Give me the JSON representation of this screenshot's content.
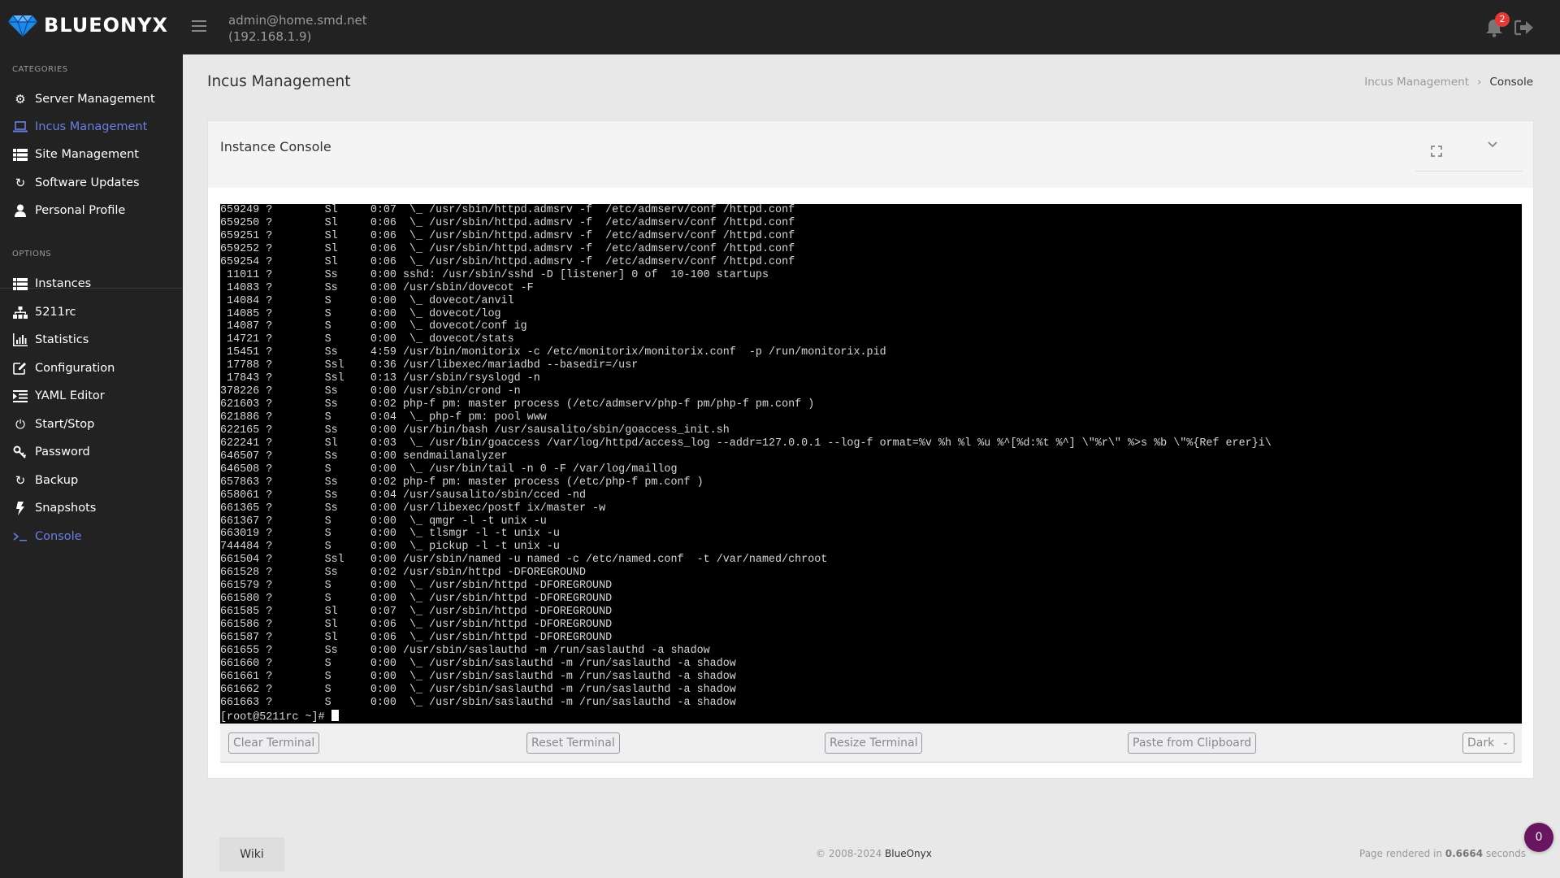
{
  "header": {
    "logo_text": "BLUEONYX",
    "user": "admin@home.smd.net",
    "ip": "(192.168.1.9)",
    "notification_count": "2",
    "brand_color": "#1e88e5"
  },
  "sidebar": {
    "categories_title": "CATEGORIES",
    "categories": [
      {
        "label": "Server Management",
        "icon": "gears-icon"
      },
      {
        "label": "Incus Management",
        "icon": "laptop-icon",
        "active": true
      },
      {
        "label": "Site Management",
        "icon": "list-icon"
      },
      {
        "label": "Software Updates",
        "icon": "refresh-icon"
      },
      {
        "label": "Personal Profile",
        "icon": "user-icon"
      }
    ],
    "options_title": "OPTIONS",
    "options": [
      {
        "label": "Instances",
        "icon": "list-icon"
      },
      {
        "label": "5211rc",
        "icon": "sitemap-icon"
      },
      {
        "label": "Statistics",
        "icon": "bar-chart-icon"
      },
      {
        "label": "Configuration",
        "icon": "edit-icon"
      },
      {
        "label": "YAML Editor",
        "icon": "indent-icon"
      },
      {
        "label": "Start/Stop",
        "icon": "power-icon"
      },
      {
        "label": "Password",
        "icon": "key-icon"
      },
      {
        "label": "Backup",
        "icon": "refresh-icon"
      },
      {
        "label": "Snapshots",
        "icon": "bolt-icon"
      },
      {
        "label": "Console",
        "icon": "terminal-icon",
        "active": true
      }
    ],
    "active_color": "#6b7fe0"
  },
  "page": {
    "title": "Incus Management",
    "breadcrumb": [
      "Incus Management",
      "Console"
    ]
  },
  "card": {
    "title": "Instance Console"
  },
  "terminal": {
    "lines": [
      "659249 ?        Sl     0:07  \\_ /usr/sbin/httpd.admsrv -f  /etc/admserv/conf /httpd.conf",
      "659250 ?        Sl     0:06  \\_ /usr/sbin/httpd.admsrv -f  /etc/admserv/conf /httpd.conf",
      "659251 ?        Sl     0:06  \\_ /usr/sbin/httpd.admsrv -f  /etc/admserv/conf /httpd.conf",
      "659252 ?        Sl     0:06  \\_ /usr/sbin/httpd.admsrv -f  /etc/admserv/conf /httpd.conf",
      "659254 ?        Sl     0:06  \\_ /usr/sbin/httpd.admsrv -f  /etc/admserv/conf /httpd.conf",
      " 11011 ?        Ss     0:00 sshd: /usr/sbin/sshd -D [listener] 0 of  10-100 startups",
      " 14083 ?        Ss     0:00 /usr/sbin/dovecot -F",
      " 14084 ?        S      0:00  \\_ dovecot/anvil",
      " 14085 ?        S      0:00  \\_ dovecot/log",
      " 14087 ?        S      0:00  \\_ dovecot/conf ig",
      " 14721 ?        S      0:00  \\_ dovecot/stats",
      " 15451 ?        Ss     4:59 /usr/bin/monitorix -c /etc/monitorix/monitorix.conf  -p /run/monitorix.pid",
      " 17788 ?        Ssl    0:36 /usr/libexec/mariadbd --basedir=/usr",
      " 17843 ?        Ssl    0:13 /usr/sbin/rsyslogd -n",
      "378226 ?        Ss     0:00 /usr/sbin/crond -n",
      "621603 ?        Ss     0:02 php-f pm: master process (/etc/admserv/php-f pm/php-f pm.conf )",
      "621886 ?        S      0:04  \\_ php-f pm: pool www",
      "622165 ?        Ss     0:00 /usr/bin/bash /usr/sausalito/sbin/goaccess_init.sh",
      "622241 ?        Sl     0:03  \\_ /usr/bin/goaccess /var/log/httpd/access_log --addr=127.0.0.1 --log-f ormat=%v %h %l %u %^[%d:%t %^] \\\"%r\\\" %>s %b \\\"%{Ref erer}i\\",
      "646507 ?        Ss     0:00 sendmailanalyzer",
      "646508 ?        S      0:00  \\_ /usr/bin/tail -n 0 -F /var/log/maillog",
      "657863 ?        Ss     0:02 php-f pm: master process (/etc/php-f pm.conf )",
      "658061 ?        Ss     0:04 /usr/sausalito/sbin/cced -nd",
      "661365 ?        Ss     0:00 /usr/libexec/postf ix/master -w",
      "661367 ?        S      0:00  \\_ qmgr -l -t unix -u",
      "663019 ?        S      0:00  \\_ tlsmgr -l -t unix -u",
      "744484 ?        S      0:00  \\_ pickup -l -t unix -u",
      "661504 ?        Ssl    0:00 /usr/sbin/named -u named -c /etc/named.conf  -t /var/named/chroot",
      "661528 ?        Ss     0:02 /usr/sbin/httpd -DFOREGROUND",
      "661579 ?        S      0:00  \\_ /usr/sbin/httpd -DFOREGROUND",
      "661580 ?        S      0:00  \\_ /usr/sbin/httpd -DFOREGROUND",
      "661585 ?        Sl     0:07  \\_ /usr/sbin/httpd -DFOREGROUND",
      "661586 ?        Sl     0:06  \\_ /usr/sbin/httpd -DFOREGROUND",
      "661587 ?        Sl     0:06  \\_ /usr/sbin/httpd -DFOREGROUND",
      "661655 ?        Ss     0:00 /usr/sbin/saslauthd -m /run/saslauthd -a shadow",
      "661660 ?        S      0:00  \\_ /usr/sbin/saslauthd -m /run/saslauthd -a shadow",
      "661661 ?        S      0:00  \\_ /usr/sbin/saslauthd -m /run/saslauthd -a shadow",
      "661662 ?        S      0:00  \\_ /usr/sbin/saslauthd -m /run/saslauthd -a shadow",
      "661663 ?        S      0:00  \\_ /usr/sbin/saslauthd -m /run/saslauthd -a shadow"
    ],
    "prompt": "[root@5211rc ~]# "
  },
  "toolbar": {
    "clear_label": "Clear Terminal",
    "reset_label": "Reset Terminal",
    "resize_label": "Resize Terminal",
    "paste_label": "Paste from Clipboard",
    "theme_selected": "Dark"
  },
  "footer": {
    "wiki_label": "Wiki",
    "copyright_prefix": "© 2008-2024 ",
    "copyright_brand": "BlueOnyx",
    "rendered_prefix": "Page rendered in ",
    "rendered_time": "0.6664",
    "rendered_suffix": " seconds",
    "fab_count": "0",
    "fab_color": "#6a1560"
  }
}
